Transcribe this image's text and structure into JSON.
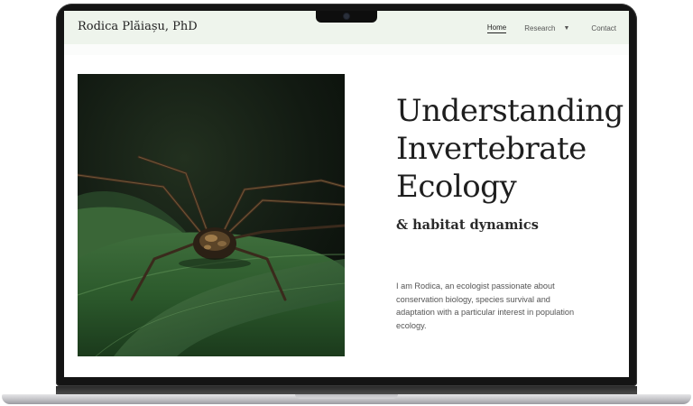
{
  "site": {
    "title": "Rodica Plăiașu, PhD"
  },
  "nav": {
    "items": [
      {
        "label": "Home",
        "active": true
      },
      {
        "label": "Research",
        "has_dropdown": true,
        "dropdown_icon": "caret-down-icon"
      },
      {
        "label": "Contact"
      }
    ]
  },
  "hero": {
    "headline_lines": [
      "Understanding",
      "Invertebrate",
      "Ecology"
    ],
    "subheadline": "& habitat dynamics",
    "intro": "I am Rodica, an ecologist passionate about conservation biology, species survival and adaptation with a particular interest in population ecology.",
    "photo_subject": "harvestman on leaf"
  },
  "colors": {
    "header_bg": "#eef4ec",
    "heading_text": "#1e1e1e",
    "body_text": "#555555",
    "laptop_bezel": "#141414"
  }
}
